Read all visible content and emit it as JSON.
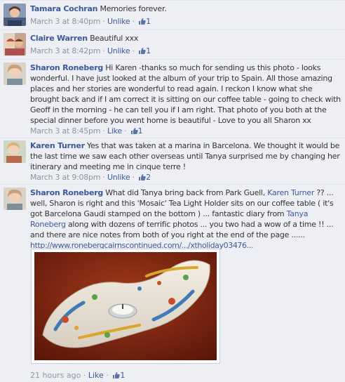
{
  "comments": [
    {
      "author": "Tamara Cochran",
      "text": "Memories forever.",
      "time": "March 3 at 8:40pm",
      "action": "Unlike",
      "likes": "1"
    },
    {
      "author": "Claire Warren",
      "text": "Beautiful xxx",
      "time": "March 3 at 8:42pm",
      "action": "Unlike",
      "likes": "1"
    },
    {
      "author": "Sharon Roneberg",
      "text": "Hi Karen -thanks so much for sending us this photo - looks wonderful. I have just looked at the album of your trip to Spain. All those amazing places and her stories are wonderful to read again. I reckon I know what she brought back and if I am correct it is sitting on our coffee table - going to check with Geoff in the morning - he can tell you if I am right. That photo of you both at the special dinner before you went home is beautiful - Love to you all Sharon xx",
      "time": "March 3 at 8:45pm",
      "action": "Like",
      "likes": "1"
    },
    {
      "author": "Karen Turner",
      "text": "Yes that was taken at a marina in Barcelona. We thought it would be the last time we saw each other overseas until Tanya surprised me by changing her itinerary and meeting me in cinque terre !",
      "time": "March 3 at 9:08pm",
      "action": "Unlike",
      "likes": "2"
    },
    {
      "author": "Sharon Roneberg",
      "text_a": "What did Tanya bring back from Park Guell,",
      "mention_a": "Karen Turner",
      "text_b": "?? ... well, Sharon is right and this 'Mosaic' Tea Light Holder sits on our coffee table ( it's got Barcelona Gaudi stamped on the bottom ) ... fantastic diary from",
      "mention_b": "Tanya Roneberg",
      "text_c": "along with dozens of terrific photos ... you two had a wow of a time !! ... and there are nice notes from both of you right at the end of the page ......",
      "url": "http://www.ronebergcairnscontinued.com/.../xtholiday03476...",
      "time": "21 hours ago",
      "action": "Like",
      "likes": "1"
    }
  ],
  "separator": " · ",
  "icons": {
    "like": "thumbs-up-icon"
  },
  "colors": {
    "background": "#edeff4",
    "link": "#3b5998",
    "meta": "#90949c",
    "text": "#333333"
  }
}
